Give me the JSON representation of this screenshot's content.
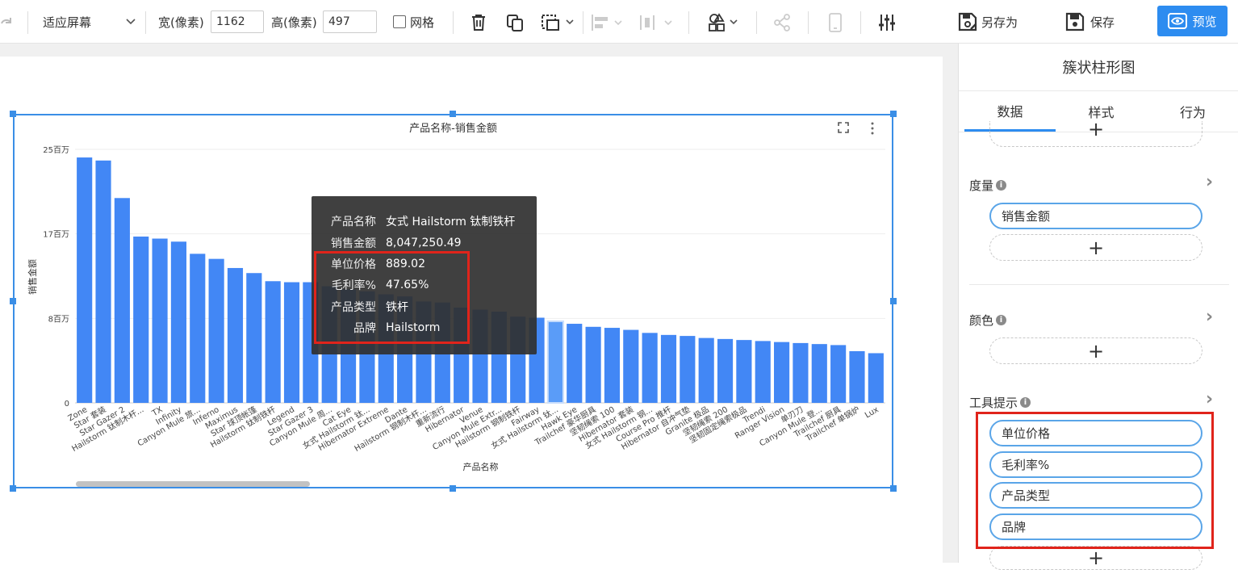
{
  "toolbar": {
    "fit_mode": "适应屏幕",
    "width_label": "宽(像素)",
    "width_value": "1162",
    "height_label": "高(像素)",
    "height_value": "497",
    "grid_label": "网格",
    "save_as_label": "另存为",
    "save_label": "保存",
    "preview_label": "预览"
  },
  "chart": {
    "title": "产品名称-销售金额",
    "y_axis_title": "销售金额",
    "x_axis_title": "产品名称"
  },
  "chart_data": {
    "type": "bar",
    "title": "产品名称-销售金额",
    "xlabel": "产品名称",
    "ylabel": "销售金额",
    "y_ticks": [
      "0",
      "8百万",
      "17百万",
      "25百万"
    ],
    "ylim": [
      0,
      25000000
    ],
    "categories": [
      "Zone",
      "Star 套装",
      "Star Gazer 2",
      "Hailstorm 钛制木杆...",
      "TX",
      "Infinity",
      "Canyon Mule 旅...",
      "Inferno",
      "Maximus",
      "Star 球顶帐篷",
      "Hailstorm 钛制铁杆",
      "Legend",
      "Star Gazer 3",
      "Canyon Mule 周...",
      "Cat Eye",
      "女式 Hailstorm 钛...",
      "Hibernator Extreme",
      "Dante",
      "Hailstorm 钢制木杆...",
      "重新流行",
      "Hibernator",
      "Venue",
      "Canyon Mule Extr...",
      "Hailstorm 钢制铁杆",
      "Fairway",
      "女式 Hailstorm 钛...",
      "Hawk Eye",
      "Trailchef 豪华厨具",
      "坚韧绳索 100",
      "Hibernator 套装",
      "女式 Hailstorm 钢...",
      "Course Pro 推杆",
      "Hibernator 自冲气垫",
      "Granite 极品",
      "坚韧绳索 200",
      "坚韧固定绳索极品",
      "Trendi",
      "Ranger Vision",
      "单刃刀",
      "Canyon Mule 登...",
      "Trailchef 厨具",
      "Trailchef 单锅炉",
      "Lux"
    ],
    "values": [
      24200000,
      23900000,
      20200000,
      16400000,
      16200000,
      15900000,
      14700000,
      14200000,
      13300000,
      12800000,
      12000000,
      11900000,
      11900000,
      11500000,
      11200000,
      11000000,
      10700000,
      10500000,
      10000000,
      9900000,
      9400000,
      9200000,
      9000000,
      8500000,
      8400000,
      8047250,
      7800000,
      7500000,
      7400000,
      7200000,
      6900000,
      6700000,
      6600000,
      6400000,
      6300000,
      6200000,
      6100000,
      6000000,
      5900000,
      5800000,
      5700000,
      5100000,
      4900000
    ],
    "highlight_index": 25,
    "bar_color": "#4287f5",
    "grid": true
  },
  "tooltip": {
    "rows": [
      {
        "key": "产品名称",
        "value": "女式 Hailstorm 钛制铁杆"
      },
      {
        "key": "销售金额",
        "value": "8,047,250.49"
      },
      {
        "key": "单位价格",
        "value": "889.02"
      },
      {
        "key": "毛利率%",
        "value": "47.65%"
      },
      {
        "key": "产品类型",
        "value": "铁杆"
      },
      {
        "key": "品牌",
        "value": "Hailstorm"
      }
    ]
  },
  "panel": {
    "title": "簇状柱形图",
    "tabs": [
      "数据",
      "样式",
      "行为"
    ],
    "active_tab": "数据",
    "measure": {
      "label": "度量",
      "fields": [
        "销售金额"
      ]
    },
    "color": {
      "label": "颜色"
    },
    "tooltip_sec": {
      "label": "工具提示",
      "fields": [
        "单位价格",
        "毛利率%",
        "产品类型",
        "品牌"
      ]
    },
    "add_symbol": "+",
    "arrow_symbol": "›"
  }
}
